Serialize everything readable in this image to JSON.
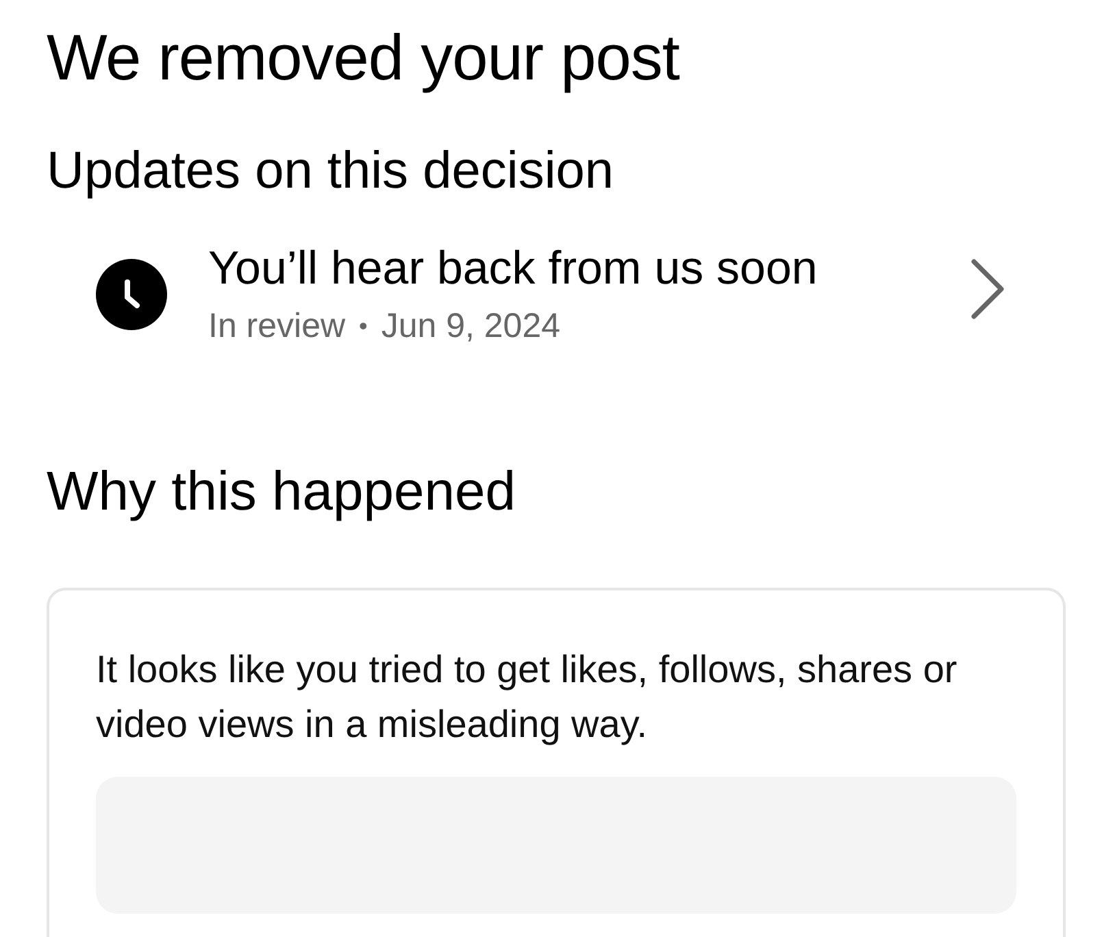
{
  "title": "We removed your post",
  "updates": {
    "heading": "Updates on this decision",
    "item": {
      "title": "You’ll hear back from us soon",
      "status": "In review",
      "separator": "•",
      "date": "Jun 9, 2024"
    }
  },
  "reason": {
    "heading": "Why this happened",
    "text": "It looks like you tried to get likes, follows, shares or video views in a misleading way."
  }
}
